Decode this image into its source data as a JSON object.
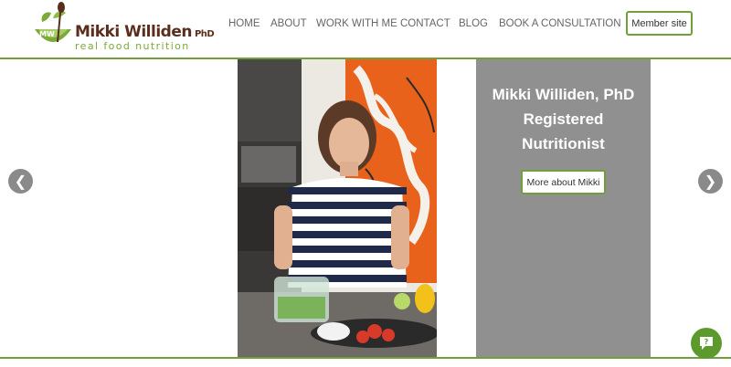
{
  "brand": {
    "name": "Mikki Williden",
    "suffix": "PhD",
    "tagline": "real food nutrition",
    "monogram": "MW"
  },
  "nav": {
    "items": [
      "HOME",
      "ABOUT",
      "WORK WITH ME",
      "CONTACT",
      "BLOG",
      "BOOK A CONSULTATION"
    ],
    "member_label": "Member site"
  },
  "hero": {
    "title_lines": [
      "Mikki Williden, PhD",
      "Registered",
      "Nutritionist"
    ],
    "cta_label": "More about Mikki",
    "prev_symbol": "❮",
    "next_symbol": "❯"
  },
  "colors": {
    "accent": "#6fa03a",
    "brand_brown": "#5a2d1c",
    "panel_gray": "#909090"
  },
  "icons": {
    "chat": "chat-icon",
    "prev": "chevron-left-icon",
    "next": "chevron-right-icon"
  }
}
